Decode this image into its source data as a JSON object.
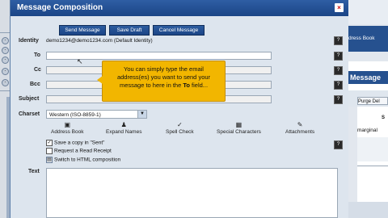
{
  "window": {
    "title": "Message Composition",
    "close_glyph": "×"
  },
  "toolbar": {
    "send_label": "Send Message",
    "save_label": "Save Draft",
    "cancel_label": "Cancel Message"
  },
  "form": {
    "identity_label": "Identity",
    "identity_value": "demo1234@demo1234.com (Default Identity)",
    "to_label": "To",
    "cc_label": "Cc",
    "bcc_label": "Bcc",
    "subject_label": "Subject",
    "charset_label": "Charset",
    "charset_value": "Western (ISO-8859-1)",
    "text_label": "Text"
  },
  "tools": [
    {
      "label": "Address Book",
      "icon": "address-book-icon"
    },
    {
      "label": "Expand Names",
      "icon": "expand-names-icon"
    },
    {
      "label": "Spell Check",
      "icon": "spell-check-icon"
    },
    {
      "label": "Special Characters",
      "icon": "special-characters-icon"
    },
    {
      "label": "Attachments",
      "icon": "attachments-icon"
    }
  ],
  "options": {
    "save_copy": "Save a copy in \"Sent\"",
    "save_copy_checked": true,
    "read_receipt": "Request a Read Receipt",
    "read_receipt_checked": false,
    "switch_html": "Switch to HTML composition"
  },
  "tooltip": {
    "line1": "You can simply type the email",
    "line2": "address(es) you want to send your",
    "line3_pre": "message to here in the ",
    "line3_bold": "To",
    "line3_post": " field..."
  },
  "right_app": {
    "address_book": "dress Book",
    "message": "Message",
    "purge": "Purge Del",
    "marginal": "marginal",
    "col": "S"
  },
  "colors": {
    "titlebar": "#1b4586",
    "tooltip": "#f2b600",
    "window_bg": "#dde5ee"
  }
}
